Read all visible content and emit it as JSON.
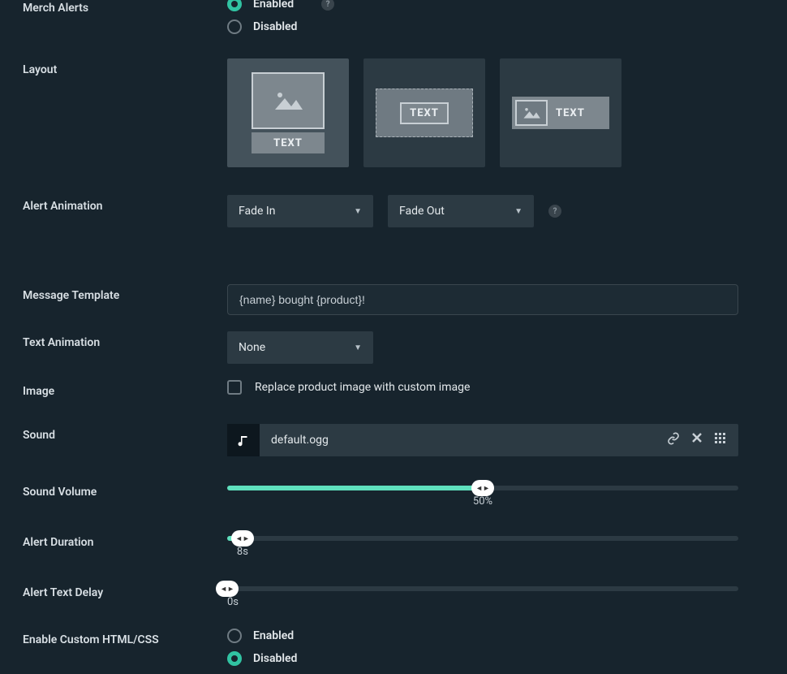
{
  "merch_alerts": {
    "label": "Merch Alerts",
    "enabled_label": "Enabled",
    "disabled_label": "Disabled",
    "value": "enabled"
  },
  "layout": {
    "label": "Layout",
    "text_token": "TEXT",
    "selected_index": 0
  },
  "alert_animation": {
    "label": "Alert Animation",
    "in_value": "Fade In",
    "out_value": "Fade Out"
  },
  "message_template": {
    "label": "Message Template",
    "value": "{name} bought {product}!"
  },
  "text_animation": {
    "label": "Text Animation",
    "value": "None"
  },
  "image": {
    "label": "Image",
    "checkbox_label": "Replace product image with custom image",
    "checked": false
  },
  "sound": {
    "label": "Sound",
    "filename": "default.ogg"
  },
  "sound_volume": {
    "label": "Sound Volume",
    "percent": 50,
    "display": "50%"
  },
  "alert_duration": {
    "label": "Alert Duration",
    "percent": 3,
    "display": "8s"
  },
  "alert_text_delay": {
    "label": "Alert Text Delay",
    "percent": 0,
    "display": "0s"
  },
  "custom_html": {
    "label": "Enable Custom HTML/CSS",
    "enabled_label": "Enabled",
    "disabled_label": "Disabled",
    "value": "disabled"
  }
}
